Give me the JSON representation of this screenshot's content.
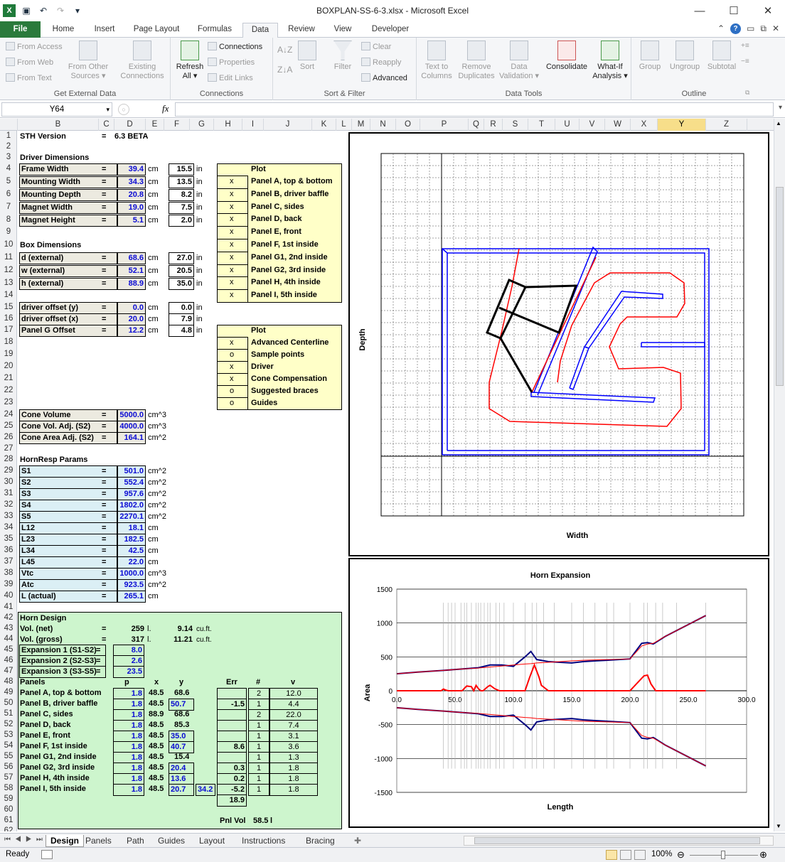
{
  "window": {
    "title": "BOXPLAN-SS-6-3.xlsx  -  Microsoft Excel"
  },
  "ribbon_tabs": [
    "File",
    "Home",
    "Insert",
    "Page Layout",
    "Formulas",
    "Data",
    "Review",
    "View",
    "Developer"
  ],
  "ribbon": {
    "from_access": "From Access",
    "from_web": "From Web",
    "from_text": "From Text",
    "from_other_1": "From Other",
    "from_other_2": "Sources",
    "from_other_arrow": "▾",
    "existing_1": "Existing",
    "existing_2": "Connections",
    "get_external": "Get External Data",
    "refresh_1": "Refresh",
    "refresh_2": "All",
    "refresh_arrow": "▾",
    "connections": "Connections",
    "properties": "Properties",
    "edit_links": "Edit Links",
    "connections_group": "Connections",
    "sort": "Sort",
    "filter": "Filter",
    "clear": "Clear",
    "reapply": "Reapply",
    "advanced": "Advanced",
    "sort_filter": "Sort & Filter",
    "text_cols_1": "Text to",
    "text_cols_2": "Columns",
    "remove_dup_1": "Remove",
    "remove_dup_2": "Duplicates",
    "validation_1": "Data",
    "validation_2": "Validation",
    "validation_arrow": "▾",
    "consolidate": "Consolidate",
    "whatif_1": "What-If",
    "whatif_2": "Analysis",
    "whatif_arrow": "▾",
    "data_tools": "Data Tools",
    "group": "Group",
    "ungroup": "Ungroup",
    "subtotal": "Subtotal",
    "outline": "Outline",
    "launcher": "⧉"
  },
  "formula_bar": {
    "name_box": "Y64",
    "fx": "fx",
    "formula": ""
  },
  "columns": [
    "B",
    "C",
    "D",
    "E",
    "F",
    "G",
    "H",
    "I",
    "J",
    "K",
    "L",
    "M",
    "N",
    "O",
    "P",
    "Q",
    "R",
    "S",
    "T",
    "U",
    "V",
    "W",
    "X",
    "Y",
    "Z"
  ],
  "rows": [
    "1",
    "2",
    "3",
    "4",
    "5",
    "6",
    "7",
    "8",
    "9",
    "10",
    "11",
    "12",
    "13",
    "14",
    "15",
    "16",
    "17",
    "18",
    "19",
    "20",
    "21",
    "22",
    "23",
    "24",
    "25",
    "26",
    "27",
    "28",
    "29",
    "30",
    "31",
    "32",
    "33",
    "34",
    "35",
    "36",
    "37",
    "38",
    "39",
    "40",
    "41",
    "42",
    "43",
    "44",
    "45",
    "46",
    "47",
    "48",
    "49",
    "50",
    "51",
    "52",
    "53",
    "54",
    "55",
    "56",
    "57",
    "58",
    "59",
    "60",
    "61",
    "62"
  ],
  "sheet": {
    "sth_label": "STH Version",
    "sth_eq": "=",
    "sth_val": "6.3 BETA",
    "driver_hdr": "Driver Dimensions",
    "driver": [
      {
        "label": "Frame Width",
        "eq": "=",
        "val": "39.4",
        "unit": "cm",
        "in": "15.5",
        "in_unit": "in"
      },
      {
        "label": "Mounting Width",
        "eq": "=",
        "val": "34.3",
        "unit": "cm",
        "in": "13.5",
        "in_unit": "in"
      },
      {
        "label": "Mounting Depth",
        "eq": "=",
        "val": "20.8",
        "unit": "cm",
        "in": "8.2",
        "in_unit": "in"
      },
      {
        "label": "Magnet Width",
        "eq": "=",
        "val": "19.0",
        "unit": "cm",
        "in": "7.5",
        "in_unit": "in"
      },
      {
        "label": "Magnet Height",
        "eq": "=",
        "val": "5.1",
        "unit": "cm",
        "in": "2.0",
        "in_unit": "in"
      }
    ],
    "box_hdr": "Box Dimensions",
    "box": [
      {
        "label": "d (external)",
        "eq": "=",
        "val": "68.6",
        "unit": "cm",
        "in": "27.0",
        "in_unit": "in"
      },
      {
        "label": "w (external)",
        "eq": "=",
        "val": "52.1",
        "unit": "cm",
        "in": "20.5",
        "in_unit": "in"
      },
      {
        "label": "h (external)",
        "eq": "=",
        "val": "88.9",
        "unit": "cm",
        "in": "35.0",
        "in_unit": "in"
      }
    ],
    "offsets": [
      {
        "label": "driver offset (y)",
        "eq": "=",
        "val": "0.0",
        "unit": "cm",
        "in": "0.0",
        "in_unit": "in"
      },
      {
        "label": "driver offset (x)",
        "eq": "=",
        "val": "20.0",
        "unit": "cm",
        "in": "7.9",
        "in_unit": "in"
      },
      {
        "label": "Panel G Offset",
        "eq": "=",
        "val": "12.2",
        "unit": "cm",
        "in": "4.8",
        "in_unit": "in"
      }
    ],
    "plot1_hdr": "Plot",
    "plot1": [
      {
        "m": "x",
        "label": "Panel A, top & bottom"
      },
      {
        "m": "x",
        "label": "Panel B, driver baffle"
      },
      {
        "m": "x",
        "label": "Panel C, sides"
      },
      {
        "m": "x",
        "label": "Panel D, back"
      },
      {
        "m": "x",
        "label": "Panel E, front"
      },
      {
        "m": "x",
        "label": "Panel F, 1st inside"
      },
      {
        "m": "x",
        "label": "Panel G1, 2nd inside"
      },
      {
        "m": "x",
        "label": "Panel G2, 3rd inside"
      },
      {
        "m": "x",
        "label": "Panel H, 4th inside"
      },
      {
        "m": "x",
        "label": "Panel I, 5th inside"
      }
    ],
    "plot2_hdr": "Plot",
    "plot2": [
      {
        "m": "x",
        "label": "Advanced Centerline"
      },
      {
        "m": "o",
        "label": "Sample points"
      },
      {
        "m": "x",
        "label": "Driver"
      },
      {
        "m": "x",
        "label": "Cone Compensation"
      },
      {
        "m": "o",
        "label": "Suggested braces"
      },
      {
        "m": "o",
        "label": "Guides"
      }
    ],
    "cone": [
      {
        "label": "Cone Volume",
        "eq": "=",
        "val": "5000.0",
        "unit": "cm^3"
      },
      {
        "label": "Cone Vol. Adj. (S2)",
        "eq": "=",
        "val": "4000.0",
        "unit": "cm^3"
      },
      {
        "label": "Cone Area Adj. (S2)",
        "eq": "=",
        "val": "164.1",
        "unit": "cm^2"
      }
    ],
    "hr_hdr": "HornResp Params",
    "hr": [
      {
        "label": "S1",
        "eq": "=",
        "val": "501.0",
        "unit": "cm^2"
      },
      {
        "label": "S2",
        "eq": "=",
        "val": "552.4",
        "unit": "cm^2"
      },
      {
        "label": "S3",
        "eq": "=",
        "val": "957.6",
        "unit": "cm^2"
      },
      {
        "label": "S4",
        "eq": "=",
        "val": "1802.0",
        "unit": "cm^2"
      },
      {
        "label": "S5",
        "eq": "=",
        "val": "2270.1",
        "unit": "cm^2"
      },
      {
        "label": "L12",
        "eq": "=",
        "val": "18.1",
        "unit": "cm"
      },
      {
        "label": "L23",
        "eq": "=",
        "val": "182.5",
        "unit": "cm"
      },
      {
        "label": "L34",
        "eq": "=",
        "val": "42.5",
        "unit": "cm"
      },
      {
        "label": "L45",
        "eq": "=",
        "val": "22.0",
        "unit": "cm"
      },
      {
        "label": "Vtc",
        "eq": "=",
        "val": "1000.0",
        "unit": "cm^3"
      },
      {
        "label": "Atc",
        "eq": "=",
        "val": "923.5",
        "unit": "cm^2"
      },
      {
        "label": "L (actual)",
        "eq": "=",
        "val": "265.1",
        "unit": "cm"
      }
    ],
    "horn_hdr": "Horn Design",
    "vol_net": {
      "label": "Vol. (net)",
      "eq": "=",
      "val": "259",
      "unit": "l.",
      "cf": "9.14",
      "cf_unit": "cu.ft."
    },
    "vol_gross": {
      "label": "Vol. (gross)",
      "eq": "=",
      "val": "317",
      "unit": "l.",
      "cf": "11.21",
      "cf_unit": "cu.ft."
    },
    "expansions": [
      {
        "label": "Expansion 1 (S1-S2)",
        "eq": "=",
        "val": "8.0"
      },
      {
        "label": "Expansion 2 (S2-S3)",
        "eq": "=",
        "val": "2.6"
      },
      {
        "label": "Expansion 3 (S3-S5)",
        "eq": "=",
        "val": "23.5"
      }
    ],
    "panels_hdr": {
      "label": "Panels",
      "p": "p",
      "x": "x",
      "y": "y",
      "err": "Err",
      "n": "#",
      "v": "v"
    },
    "panels": [
      {
        "label": "Panel A, top & bottom",
        "p": "1.8",
        "x": "48.5",
        "y": "68.6",
        "err": "",
        "n": "2",
        "v": "12.0"
      },
      {
        "label": "Panel B, driver baffle",
        "p": "1.8",
        "x": "48.5",
        "y": "50.7",
        "err": "-1.5",
        "n": "1",
        "v": "4.4"
      },
      {
        "label": "Panel C, sides",
        "p": "1.8",
        "x": "88.9",
        "y": "68.6",
        "err": "",
        "n": "2",
        "v": "22.0"
      },
      {
        "label": "Panel D, back",
        "p": "1.8",
        "x": "48.5",
        "y": "85.3",
        "err": "",
        "n": "1",
        "v": "7.4"
      },
      {
        "label": "Panel E, front",
        "p": "1.8",
        "x": "48.5",
        "y": "35.0",
        "err": "",
        "n": "1",
        "v": "3.1"
      },
      {
        "label": "Panel F, 1st inside",
        "p": "1.8",
        "x": "48.5",
        "y": "40.7",
        "err": "8.6",
        "n": "1",
        "v": "3.6"
      },
      {
        "label": "Panel G1, 2nd inside",
        "p": "1.8",
        "x": "48.5",
        "y": "15.4",
        "err": "",
        "n": "1",
        "v": "1.3"
      },
      {
        "label": "Panel G2, 3rd inside",
        "p": "1.8",
        "x": "48.5",
        "y": "20.4",
        "err": "0.3",
        "n": "1",
        "v": "1.8"
      },
      {
        "label": "Panel H, 4th inside",
        "p": "1.8",
        "x": "48.5",
        "y": "13.6",
        "err": "0.2",
        "n": "1",
        "v": "1.8"
      },
      {
        "label": "Panel I, 5th inside",
        "p": "1.8",
        "x": "48.5",
        "y": "20.7",
        "extra": "34.2",
        "err": "-5.2",
        "n": "1",
        "v": "1.8"
      }
    ],
    "err_total": "18.9",
    "pnl_vol": {
      "label": "Pnl Vol",
      "val": "58.5",
      "unit": "l"
    }
  },
  "chart_data": [
    {
      "type": "line",
      "title": "",
      "xlabel": "Width",
      "ylabel": "Depth"
    },
    {
      "type": "line",
      "title": "Horn Expansion",
      "xlabel": "Length",
      "ylabel": "Area",
      "xlim": [
        0,
        300
      ],
      "ylim": [
        -1500,
        1500
      ],
      "xticks": [
        "0.0",
        "50.0",
        "100.0",
        "150.0",
        "200.0",
        "250.0",
        "300.0"
      ],
      "yticks": [
        "1500",
        "1000",
        "500",
        "0",
        "-500",
        "-1000",
        "-1500"
      ],
      "series": [
        {
          "color": "#00007f",
          "x": [
            0,
            18,
            40,
            55,
            70,
            80,
            90,
            100,
            110,
            115,
            120,
            130,
            140,
            150,
            160,
            170,
            180,
            200,
            210,
            215,
            220,
            230,
            265
          ],
          "y": [
            250,
            275,
            300,
            320,
            340,
            380,
            380,
            360,
            500,
            580,
            460,
            430,
            420,
            410,
            430,
            440,
            450,
            470,
            700,
            710,
            690,
            800,
            1110
          ]
        },
        {
          "color": "#ff0000",
          "x": [
            0,
            18,
            40,
            55,
            70,
            80,
            90,
            100,
            110,
            115,
            120,
            130,
            140,
            150,
            160,
            170,
            180,
            200,
            210,
            215,
            220,
            230,
            265
          ],
          "y": [
            250,
            275,
            300,
            320,
            335,
            350,
            365,
            380,
            395,
            400,
            410,
            420,
            430,
            440,
            450,
            455,
            460,
            470,
            660,
            690,
            700,
            800,
            1110
          ]
        },
        {
          "color": "#ff0000",
          "x": [
            0,
            38,
            40,
            42,
            44,
            50,
            56,
            60,
            64,
            66,
            68,
            70,
            72,
            74,
            78,
            80,
            84,
            88,
            110,
            114,
            118,
            122,
            124,
            130,
            140,
            160,
            180,
            200,
            212,
            215,
            218,
            222,
            230,
            265
          ],
          "y": [
            0,
            0,
            25,
            10,
            0,
            0,
            0,
            70,
            60,
            0,
            80,
            30,
            0,
            0,
            60,
            80,
            30,
            0,
            0,
            200,
            380,
            200,
            80,
            0,
            0,
            0,
            0,
            0,
            220,
            230,
            100,
            0,
            0,
            0
          ]
        },
        {
          "color": "#00007f",
          "x": [
            0,
            18,
            40,
            55,
            70,
            80,
            90,
            100,
            110,
            115,
            120,
            130,
            140,
            150,
            160,
            170,
            180,
            200,
            210,
            215,
            220,
            230,
            265
          ],
          "y": [
            -250,
            -275,
            -300,
            -320,
            -340,
            -380,
            -380,
            -360,
            -500,
            -580,
            -460,
            -430,
            -420,
            -410,
            -430,
            -440,
            -450,
            -470,
            -700,
            -710,
            -690,
            -800,
            -1110
          ]
        },
        {
          "color": "#ff0000",
          "x": [
            0,
            18,
            40,
            55,
            70,
            80,
            90,
            100,
            110,
            115,
            120,
            130,
            140,
            150,
            160,
            170,
            180,
            200,
            210,
            215,
            220,
            230,
            265
          ],
          "y": [
            -250,
            -275,
            -300,
            -320,
            -335,
            -350,
            -365,
            -380,
            -395,
            -400,
            -410,
            -420,
            -430,
            -440,
            -450,
            -455,
            -460,
            -470,
            -660,
            -690,
            -700,
            -800,
            -1110
          ]
        }
      ]
    }
  ],
  "sheet_tabs": [
    "Design",
    "Panels",
    "Path",
    "Guides",
    "Layout",
    "Instructions",
    "Bracing"
  ],
  "status": {
    "ready": "Ready",
    "zoom": "100%"
  }
}
